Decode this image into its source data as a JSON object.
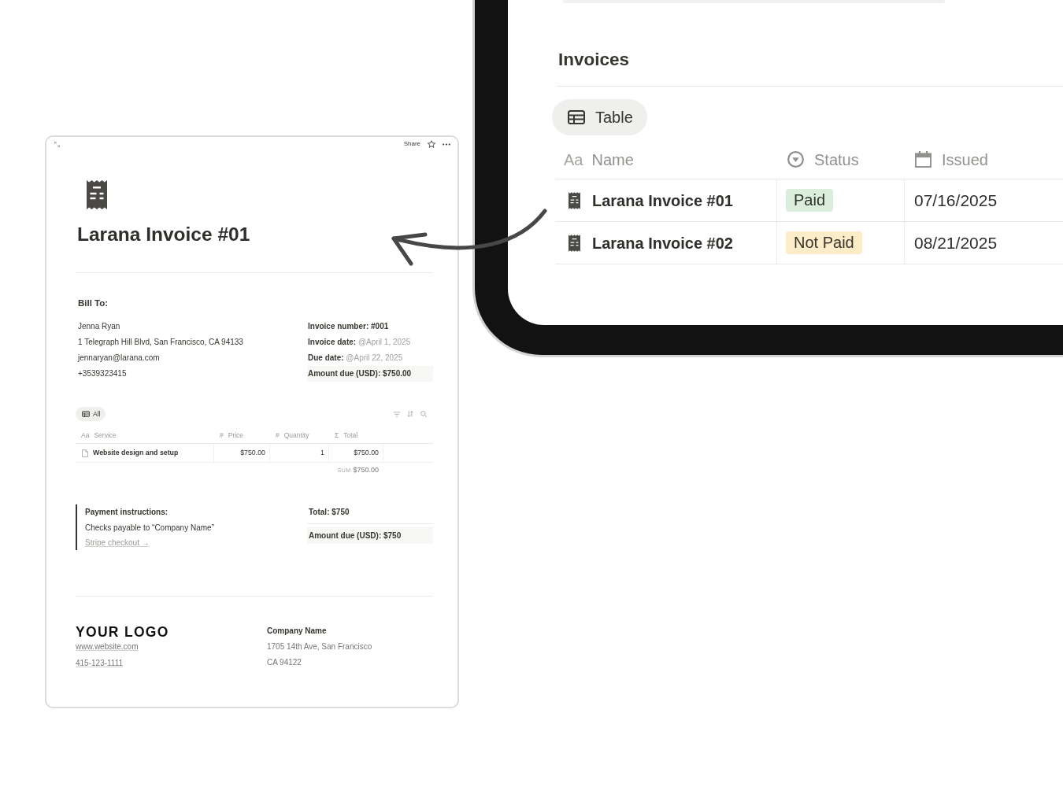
{
  "invoice_page": {
    "toolbar": {
      "share": "Share"
    },
    "title": "Larana Invoice #01",
    "bill_to": {
      "heading": "Bill To:",
      "lines": [
        "Jenna Ryan",
        "1 Telegraph Hill Blvd, San Francisco, CA 94133",
        "jennaryan@larana.com",
        "+3539323415"
      ]
    },
    "details": [
      {
        "kind": "text",
        "label": "Invoice number:",
        "value": "#001"
      },
      {
        "kind": "date",
        "label": "Invoice date:",
        "value": "@April 1, 2025"
      },
      {
        "kind": "date",
        "label": "Due date:",
        "value": "@April 22, 2025"
      },
      {
        "kind": "highlight",
        "label": "Amount due (USD):",
        "value": "$750.00"
      }
    ],
    "views": [
      {
        "label": "All",
        "selected": true
      }
    ],
    "table": {
      "columns": [
        {
          "kind": "text",
          "glyph": "Aa",
          "label": "Service"
        },
        {
          "kind": "number",
          "glyph": "#",
          "label": "Price"
        },
        {
          "kind": "number",
          "glyph": "#",
          "label": "Quantity"
        },
        {
          "kind": "formula",
          "glyph": "Σ",
          "label": "Total"
        }
      ],
      "rows": [
        {
          "cells": [
            "Website design and setup",
            "$750.00",
            "1",
            "$750.00"
          ]
        }
      ],
      "sum": {
        "label": "SUM",
        "value": "$750.00"
      }
    },
    "payment": {
      "heading": "Payment instructions:",
      "text": "Checks payable to “Company Name”",
      "link": "Stripe checkout →"
    },
    "totals": [
      {
        "kind": "text",
        "label": "Total:",
        "value": "$750"
      },
      {
        "kind": "highlight",
        "label": "Amount due (USD):",
        "value": "$750"
      }
    ],
    "footer": {
      "logo": "YOUR LOGO",
      "links": [
        "www.website.com",
        "415-123-1111"
      ],
      "company": "Company Name",
      "address": [
        "1705 14th Ave, San Francisco",
        "CA 94122"
      ]
    }
  },
  "tablet_page": {
    "heading": "Invoices",
    "views": [
      {
        "label": "Table",
        "selected": true
      }
    ],
    "columns": [
      {
        "kind": "text",
        "glyph": "Aa",
        "label": "Name"
      },
      {
        "kind": "status",
        "label": "Status"
      },
      {
        "kind": "date",
        "label": "Issued"
      }
    ],
    "rows": [
      {
        "name": "Larana Invoice #01",
        "status": {
          "label": "Paid",
          "color": "#dbeddb"
        },
        "issued": "07/16/2025"
      },
      {
        "name": "Larana Invoice #02",
        "status": {
          "label": "Not Paid",
          "color": "#fdecc8"
        },
        "issued": "08/21/2025"
      }
    ]
  }
}
